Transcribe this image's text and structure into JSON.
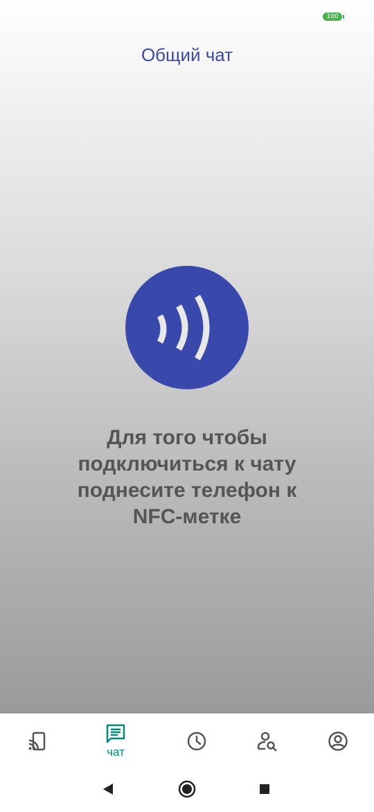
{
  "status_bar": {
    "battery_level": "100",
    "battery_color": "#4caf50"
  },
  "header": {
    "title": "Общий чат",
    "title_color": "#3949ab"
  },
  "nfc": {
    "icon": "nfc-icon",
    "circle_color": "#3949ab"
  },
  "message": {
    "text": "Для того чтобы\nподключиться к чату\nподнесите телефон к\nNFC-метке"
  },
  "bottom_nav": {
    "active_color": "#00897b",
    "items": [
      {
        "icon": "cast-icon",
        "label": ""
      },
      {
        "icon": "chat-icon",
        "label": "чат",
        "active": true
      },
      {
        "icon": "clock-icon",
        "label": ""
      },
      {
        "icon": "user-search-icon",
        "label": ""
      },
      {
        "icon": "account-icon",
        "label": ""
      }
    ]
  },
  "system_nav": {
    "items": [
      {
        "icon": "back-icon"
      },
      {
        "icon": "home-icon"
      },
      {
        "icon": "recents-icon"
      }
    ]
  }
}
